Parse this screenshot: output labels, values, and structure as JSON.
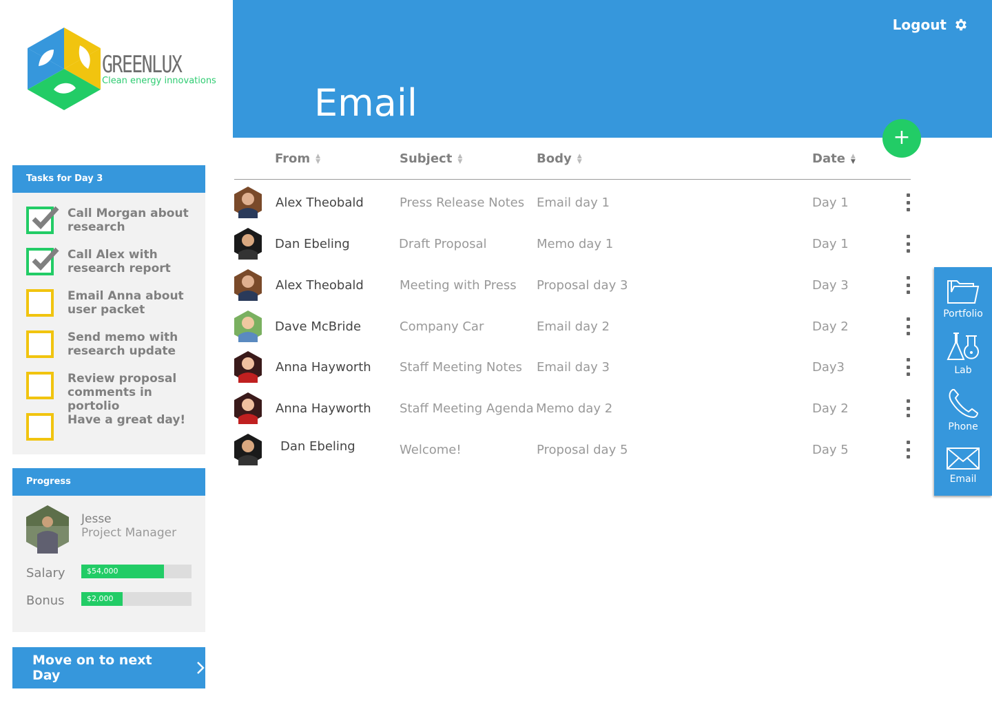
{
  "brand": {
    "name": "GREENLUX",
    "tagline": "Clean energy innovations"
  },
  "header": {
    "title": "Email",
    "logout_label": "Logout",
    "add_label": "+"
  },
  "tasks": {
    "title": "Tasks for Day 3",
    "items": [
      {
        "label": "Call Morgan about research",
        "done": true
      },
      {
        "label": "Call Alex with research report",
        "done": true
      },
      {
        "label": "Email Anna about user packet",
        "done": false
      },
      {
        "label": "Send memo with research update",
        "done": false
      },
      {
        "label": "Review proposal comments in portolio",
        "done": false
      },
      {
        "label": "Have a great day!",
        "done": false
      }
    ]
  },
  "progress": {
    "title": "Progress",
    "user_name": "Jesse",
    "user_role": "Project Manager",
    "salary_label": "Salary",
    "salary_value": "$54,000",
    "salary_fraction": 0.75,
    "bonus_label": "Bonus",
    "bonus_value": "$2,000",
    "bonus_fraction": 0.375
  },
  "next_day_label": "Move on to next Day",
  "table": {
    "columns": [
      "From",
      "Subject",
      "Body",
      "Date"
    ],
    "rows": [
      {
        "from": "Alex Theobald",
        "subject": "Press Release Notes",
        "body": "Email day 1",
        "date": "Day 1"
      },
      {
        "from": "Dan Ebeling",
        "subject": "Draft Proposal",
        "body": "Memo day 1",
        "date": "Day 1"
      },
      {
        "from": "Alex Theobald",
        "subject": "Meeting with Press",
        "body": "Proposal day 3",
        "date": "Day 3"
      },
      {
        "from": "Dave McBride",
        "subject": "Company Car",
        "body": "Email day 2",
        "date": "Day 2"
      },
      {
        "from": "Anna Hayworth",
        "subject": "Staff Meeting Notes",
        "body": "Email day 3",
        "date": "Day3"
      },
      {
        "from": "Anna Hayworth",
        "subject": "Staff Meeting Agenda",
        "body": "Memo day 2",
        "date": "Day 2"
      },
      {
        "from": "Dan Ebeling",
        "subject": "Welcome!",
        "body": "Proposal day 5",
        "date": "Day 5"
      }
    ]
  },
  "dock": {
    "items": [
      {
        "label": "Portfolio",
        "icon": "folder-icon"
      },
      {
        "label": "Lab",
        "icon": "flask-icon"
      },
      {
        "label": "Phone",
        "icon": "phone-icon"
      },
      {
        "label": "Email",
        "icon": "envelope-icon"
      }
    ]
  },
  "colors": {
    "primary": "#3697dc",
    "success": "#22cc66",
    "warning": "#f1c40f",
    "panel": "#f2f2f2"
  }
}
